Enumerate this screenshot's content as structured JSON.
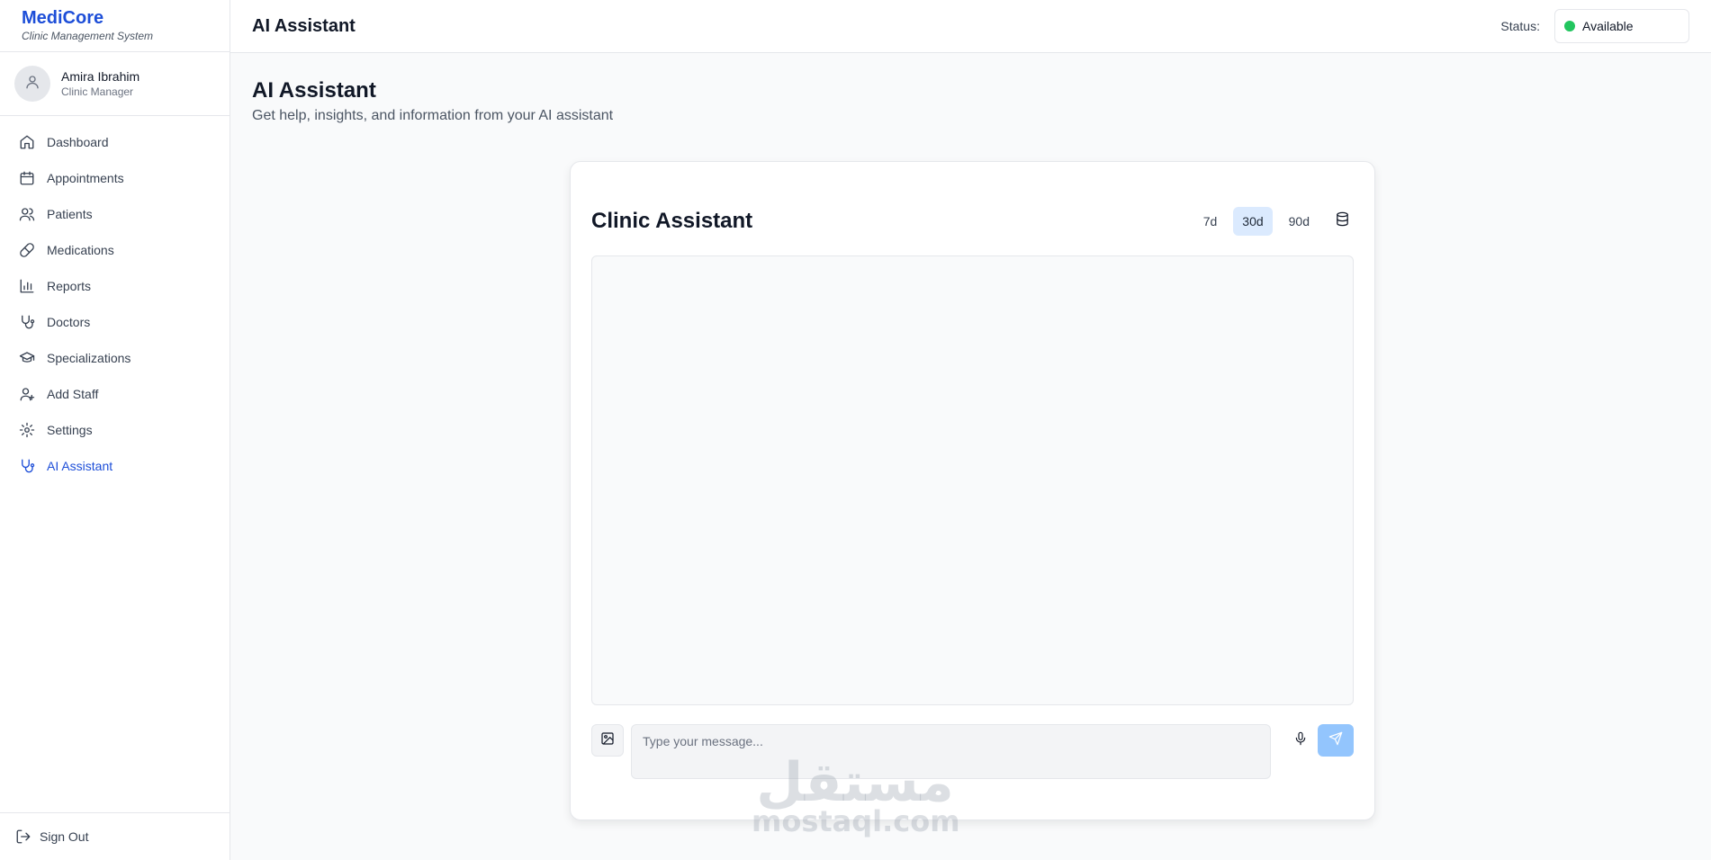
{
  "brand": {
    "name": "MediCore",
    "subtitle": "Clinic Management System"
  },
  "user": {
    "name": "Amira Ibrahim",
    "role": "Clinic Manager",
    "icon": "user-icon"
  },
  "sidebar": {
    "items": [
      {
        "label": "Dashboard",
        "icon": "home-icon",
        "active": false
      },
      {
        "label": "Appointments",
        "icon": "calendar-icon",
        "active": false
      },
      {
        "label": "Patients",
        "icon": "users-icon",
        "active": false
      },
      {
        "label": "Medications",
        "icon": "pill-icon",
        "active": false
      },
      {
        "label": "Reports",
        "icon": "bar-chart-icon",
        "active": false
      },
      {
        "label": "Doctors",
        "icon": "stethoscope-icon",
        "active": false
      },
      {
        "label": "Specializations",
        "icon": "graduation-cap-icon",
        "active": false
      },
      {
        "label": "Add Staff",
        "icon": "user-plus-icon",
        "active": false
      },
      {
        "label": "Settings",
        "icon": "gear-icon",
        "active": false
      },
      {
        "label": "AI Assistant",
        "icon": "stethoscope-icon",
        "active": true
      }
    ],
    "signout": "Sign Out"
  },
  "header": {
    "title": "AI Assistant",
    "status_label": "Status:",
    "status_value": "Available",
    "status_color": "#22c55e"
  },
  "page": {
    "title": "AI Assistant",
    "subtitle": "Get help, insights, and information from your AI assistant"
  },
  "assistant": {
    "title": "Clinic Assistant",
    "ranges": [
      "7d",
      "30d",
      "90d"
    ],
    "selected_range": "30d",
    "input_placeholder": "Type your message..."
  },
  "watermark": {
    "arabic": "مستقل",
    "latin": "mostaql.com"
  },
  "colors": {
    "accent": "#1d4ed8",
    "active_range_bg": "#dbeafe",
    "send_button": "#93c5fd"
  }
}
